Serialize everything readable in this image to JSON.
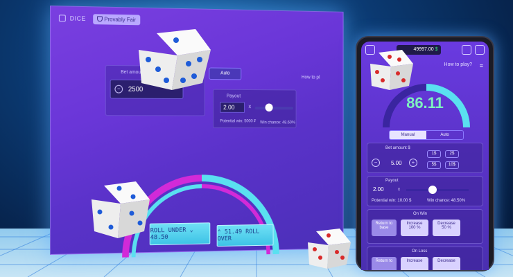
{
  "desktop": {
    "app_name": "DICE",
    "provably_fair": "Provably Fair",
    "bet_amount_label": "Bet amou",
    "bet_amount_value": "2500",
    "mode_tab": "Auto",
    "how_to_play": "How to pl",
    "payout_label": "Payout",
    "payout_value": "2.00",
    "payout_x": "x",
    "potential_win_label": "Potential win: 5000 ₣",
    "win_chance_label": "Win chance: 48.60%",
    "roll_under_label": "ROLL UNDER ⌄ 48.50",
    "roll_over_label": "⌃ 51.49 ROLL OVER"
  },
  "phone": {
    "balance": "49997.00",
    "currency_symbol": "$",
    "how_to_play": "How to play?",
    "roll_result": "86.11",
    "tabs": [
      "Manual",
      "Auto"
    ],
    "bet_amount_label": "Bet amount $",
    "bet_amount_value": "5.00",
    "quick_values": [
      "1$",
      "2$",
      "5$",
      "10$"
    ],
    "payout_label": "Payout",
    "payout_value": "2.00",
    "payout_x": "x",
    "potential_win": "Potential win: 10.00 $",
    "win_chance": "Win chance: 48.50%",
    "on_win_label": "On Win",
    "return_to_base": "Return to base",
    "increase_label": "Increase",
    "increase_value": "100",
    "decrease_label": "Decrease",
    "decrease_value": "50",
    "percent": "%",
    "on_loss_label": "On Loss",
    "return_to_base_2": "Return to",
    "increase_label_2": "Increase",
    "decrease_label_2": "Decrease"
  },
  "colors": {
    "accent_cyan": "#6fe0f5",
    "accent_green": "#38e07a",
    "result_green": "#7ef0c0",
    "die_pip_blue": "#1e5bd8",
    "die_pip_red": "#d82a2a"
  }
}
